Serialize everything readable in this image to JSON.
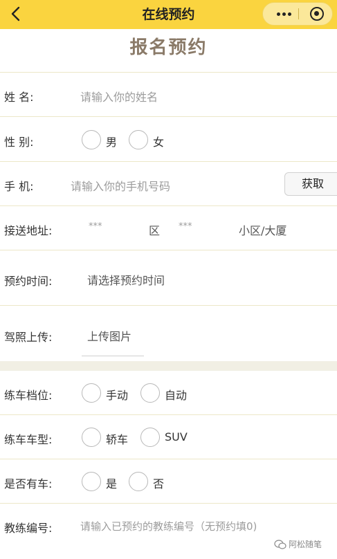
{
  "nav": {
    "title": "在线预约"
  },
  "page": {
    "heading": "报名预约"
  },
  "form": {
    "name": {
      "label": "姓 名:",
      "placeholder": "请输入你的姓名"
    },
    "gender": {
      "label": "性 别:",
      "options": [
        "男",
        "女"
      ]
    },
    "phone": {
      "label": "手 机:",
      "placeholder": "请输入你的手机号码",
      "button": "获取"
    },
    "address": {
      "label": "接送地址:",
      "district_value": "***",
      "district_suffix": "区",
      "community_value": "***",
      "community_suffix": "小区/大厦"
    },
    "time": {
      "label": "预约时间:",
      "value": "请选择预约时间"
    },
    "license": {
      "label": "驾照上传:",
      "value": "上传图片"
    },
    "gear": {
      "label": "练车档位:",
      "options": [
        "手动",
        "自动"
      ]
    },
    "car_type": {
      "label": "练车车型:",
      "options": [
        "轿车",
        "SUV"
      ]
    },
    "has_car": {
      "label": "是否有车:",
      "options": [
        "是",
        "否"
      ]
    },
    "coach": {
      "label": "教练编号:",
      "placeholder": "请输入已预约的教练编号（无预约填0)"
    }
  },
  "watermark": {
    "text": "阿松随笔"
  }
}
